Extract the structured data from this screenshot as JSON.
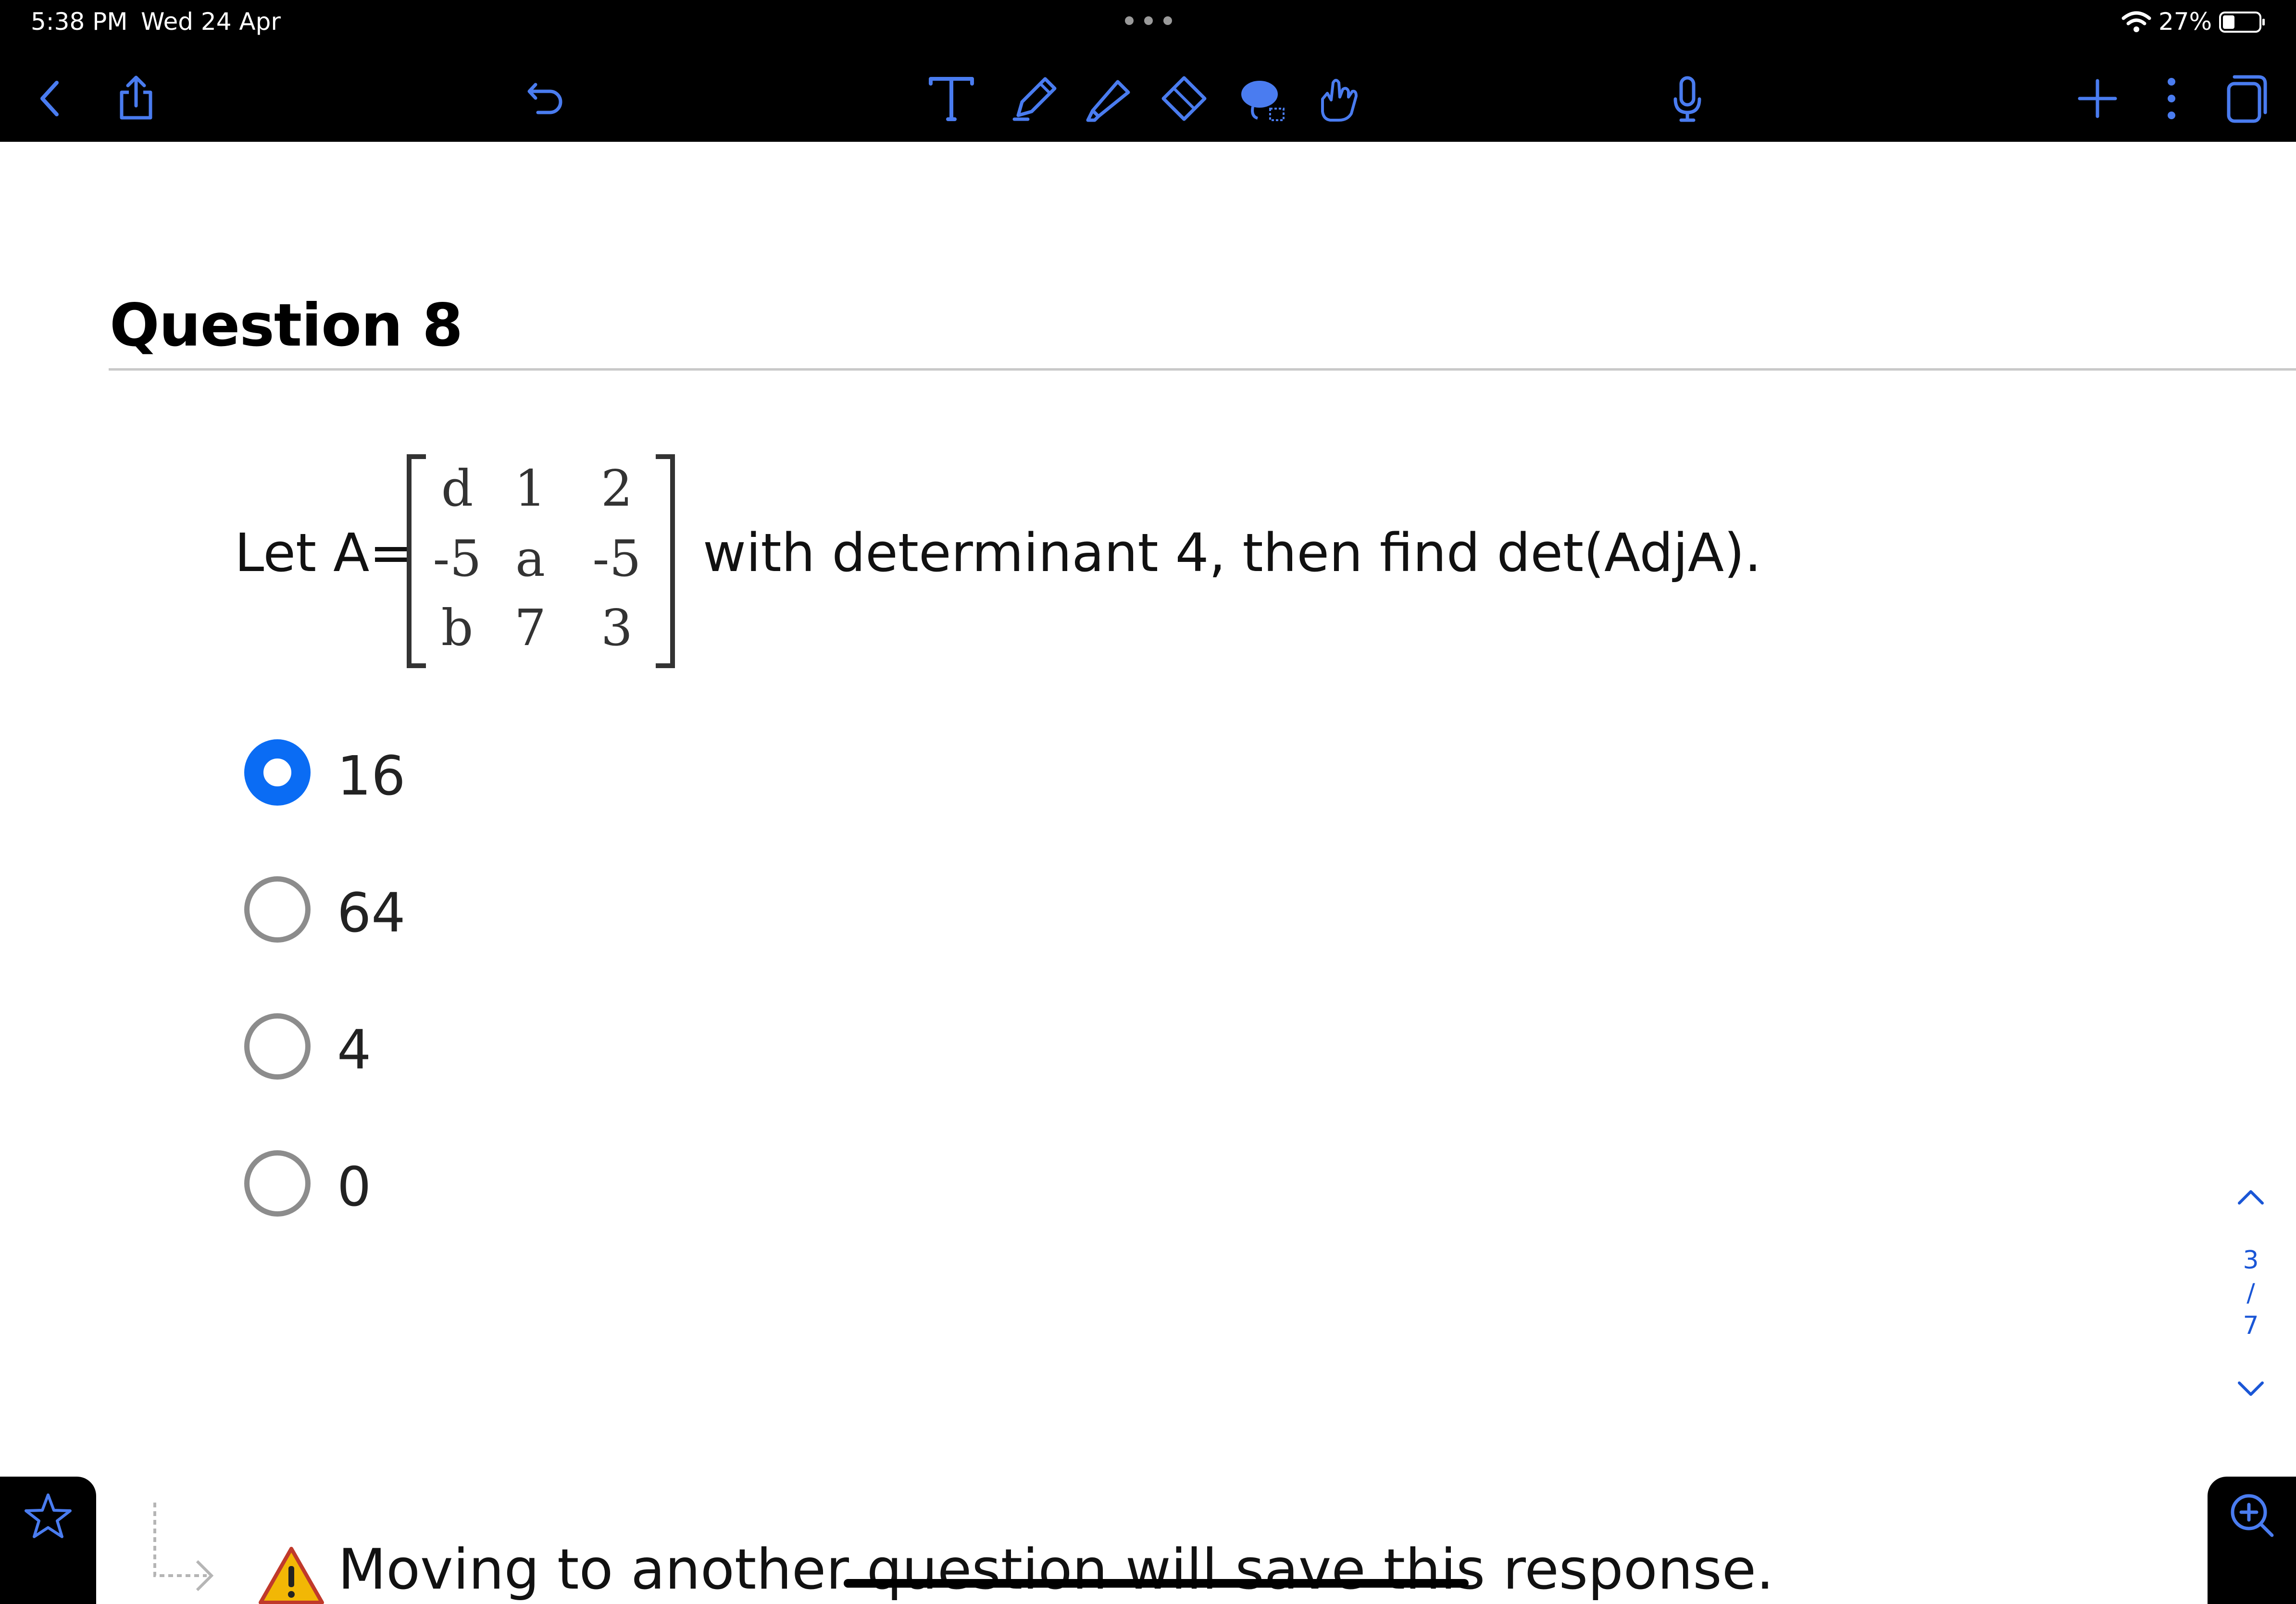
{
  "status_bar": {
    "time": "5:38 PM",
    "date": "Wed 24 Apr",
    "battery": "27%"
  },
  "toolbar": {
    "icons": [
      "back-chevron-icon",
      "share-icon",
      "undo-icon",
      "text-tool-icon",
      "pen-icon",
      "highlighter-icon",
      "eraser-icon",
      "lasso-icon",
      "hand-pointer-icon",
      "microphone-icon",
      "add-icon",
      "more-icon",
      "pages-icon"
    ],
    "accent": "#4a7cf0"
  },
  "question": {
    "title": "Question 8",
    "stem_prefix": "Let A=",
    "stem_suffix": "with determinant 4, then find det(AdjA).",
    "matrix": [
      [
        "d",
        "1",
        "2"
      ],
      [
        "-5",
        "a",
        "-5"
      ],
      [
        "b",
        "7",
        "3"
      ]
    ],
    "options": [
      {
        "label": "16",
        "selected": true
      },
      {
        "label": "64",
        "selected": false
      },
      {
        "label": "4",
        "selected": false
      },
      {
        "label": "0",
        "selected": false
      }
    ],
    "selected_color": "#0a6cf4"
  },
  "pager": {
    "current": "3",
    "separator": "/",
    "total": "7"
  },
  "footer": {
    "notice": "Moving to another question will save this response."
  }
}
